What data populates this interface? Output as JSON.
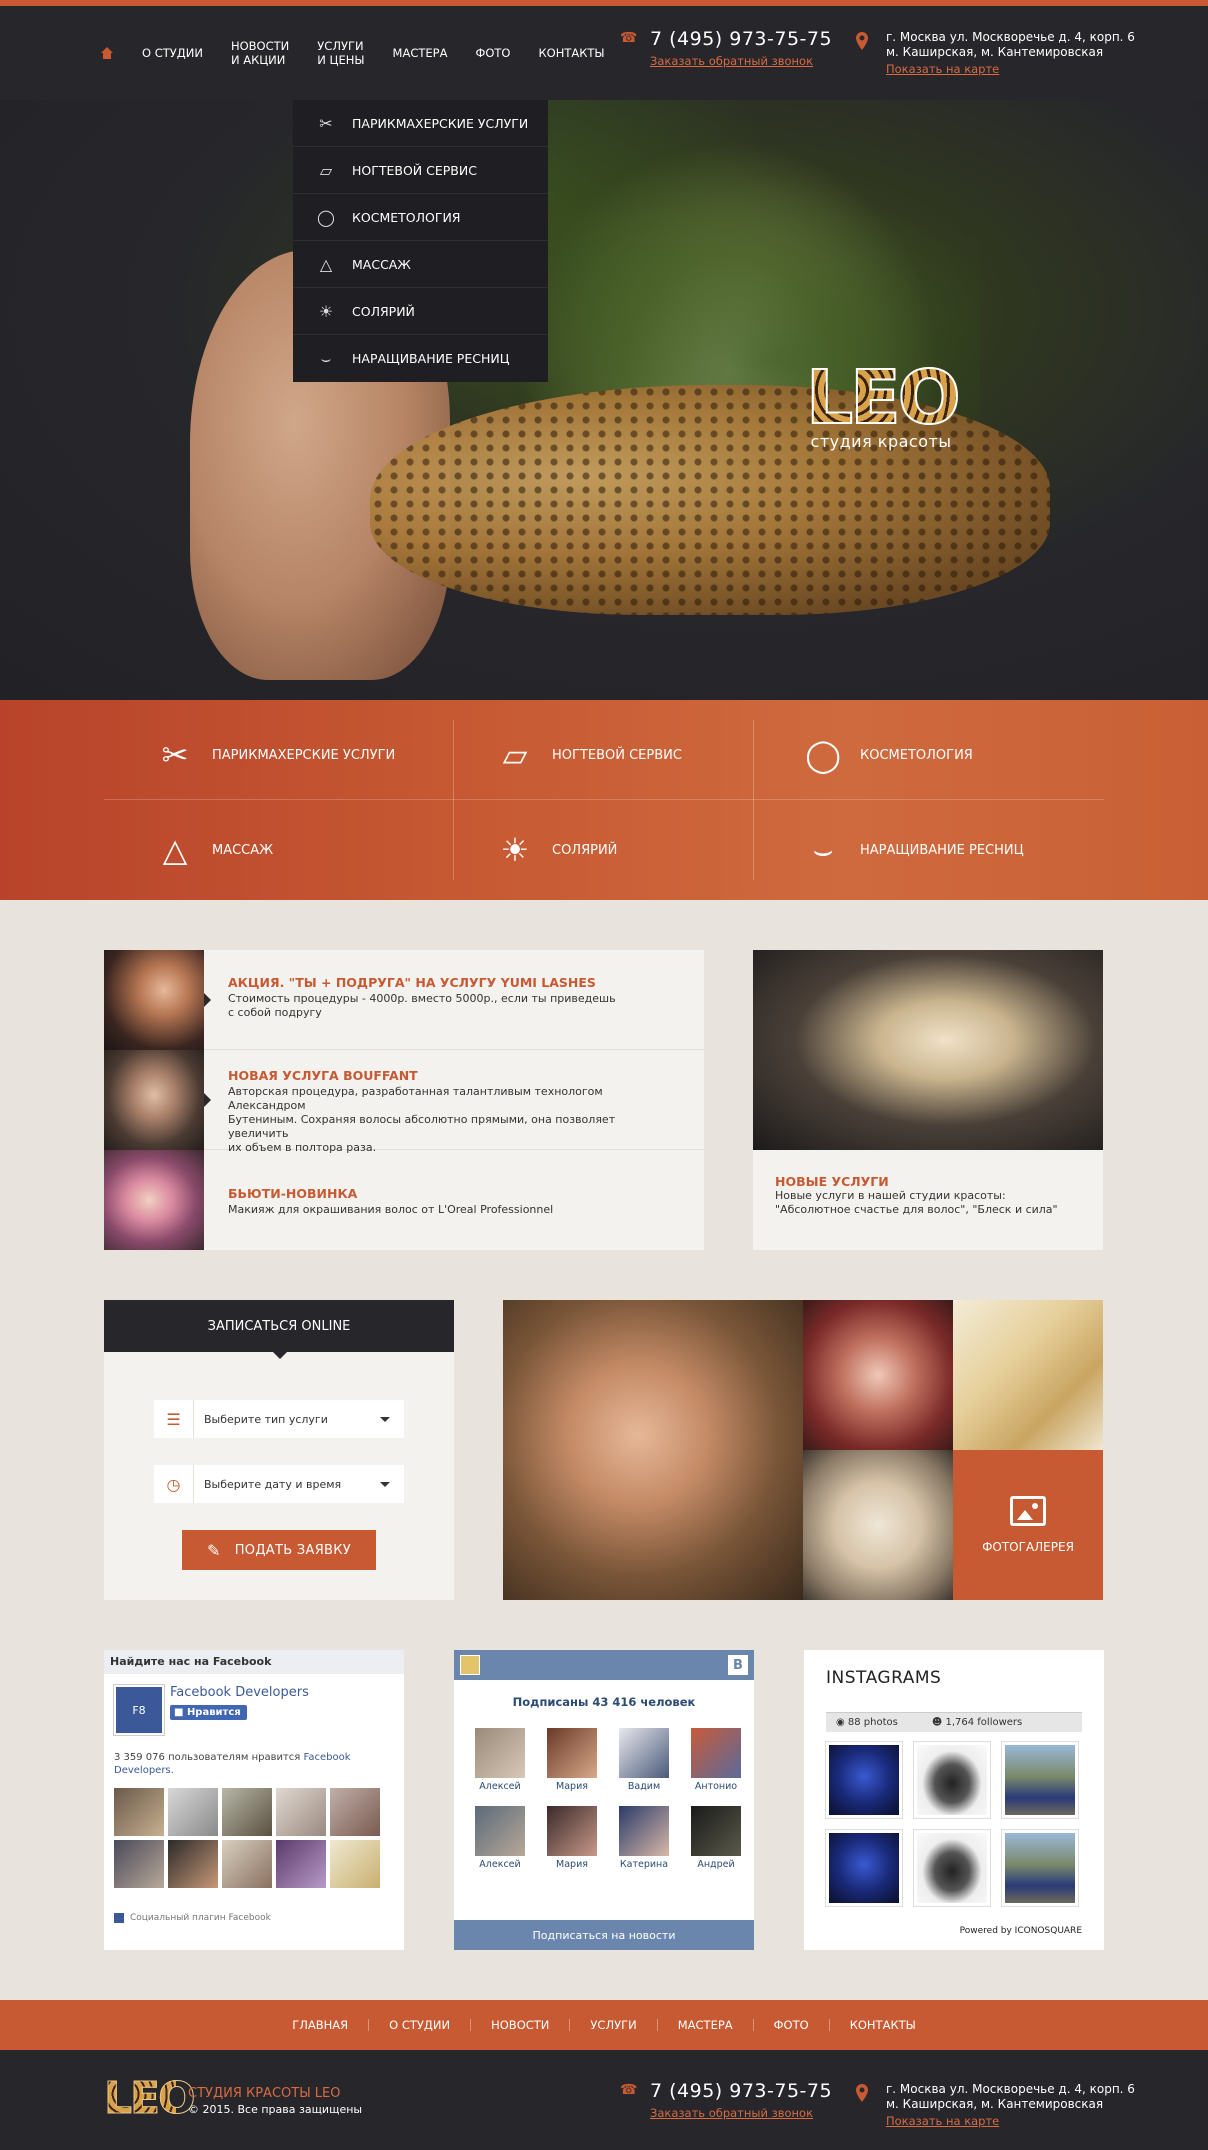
{
  "header": {
    "nav": [
      "О СТУДИИ",
      "НОВОСТИ\nИ АКЦИИ",
      "УСЛУГИ\nИ ЦЕНЫ",
      "МАСТЕРА",
      "ФОТО",
      "КОНТАКТЫ"
    ],
    "phone": "7 (495) 973-75-75",
    "callback": "Заказать обратный звонок",
    "address_line1": "г. Москва ул. Москворечье д. 4, корп. 6",
    "address_line2": "м. Каширская, м. Кантемировская",
    "map_link": "Показать на карте"
  },
  "hero": {
    "logo": "LEO",
    "logo_sub": "студия красоты"
  },
  "dropdown": [
    {
      "label": "ПАРИКМАХЕРСКИЕ УСЛУГИ",
      "icon": "scissors-icon"
    },
    {
      "label": "НОГТЕВОЙ СЕРВИС",
      "icon": "nail-polish-icon"
    },
    {
      "label": "КОСМЕТОЛОГИЯ",
      "icon": "compact-icon"
    },
    {
      "label": "МАССАЖ",
      "icon": "massage-icon"
    },
    {
      "label": "СОЛЯРИЙ",
      "icon": "sun-icon"
    },
    {
      "label": "НАРАЩИВАНИЕ РЕСНИЦ",
      "icon": "eyelash-icon"
    }
  ],
  "services": [
    {
      "label": "ПАРИКМАХЕРСКИЕ УСЛУГИ",
      "icon": "scissors-icon"
    },
    {
      "label": "НОГТЕВОЙ СЕРВИС",
      "icon": "nail-polish-icon"
    },
    {
      "label": "КОСМЕТОЛОГИЯ",
      "icon": "compact-icon"
    },
    {
      "label": "МАССАЖ",
      "icon": "massage-icon"
    },
    {
      "label": "СОЛЯРИЙ",
      "icon": "sun-icon"
    },
    {
      "label": "НАРАЩИВАНИЕ РЕСНИЦ",
      "icon": "eyelash-icon"
    }
  ],
  "news": [
    {
      "title": "АКЦИЯ. \"ТЫ + ПОДРУГА\" НА УСЛУГУ YUMI LASHES",
      "desc": "Стоимость процедуры - 4000р. вместо 5000р., если ты приведешь\nс собой подругу"
    },
    {
      "title": "НОВАЯ УСЛУГА BOUFFANT",
      "desc": "Авторская процедура, разработанная талантливым технологом Александром\nБутениным. Сохраняя волосы абсолютно прямыми, она позволяет увеличить\nих объем в полтора раза."
    },
    {
      "title": "БЬЮТИ-НОВИНКА",
      "desc": "Макияж для окрашивания волос от L'Oreal Professionnel"
    }
  ],
  "feature": {
    "title": "НОВЫЕ УСЛУГИ",
    "desc": "Новые услуги в нашей студии красоты:\n\"Абсолютное счастье для волос\", \"Блеск и сила\""
  },
  "booking": {
    "title": "ЗАПИСАТЬСЯ ONLINE",
    "service_select": "Выберите тип услуги",
    "date_select": "Выберите дату и время",
    "submit": "ПОДАТЬ ЗАЯВКУ"
  },
  "gallery": {
    "label": "ФОТОГАЛЕРЕЯ"
  },
  "facebook": {
    "header": "Найдите нас на Facebook",
    "page_name": "Facebook Developers",
    "page_badge": "F8",
    "like": "Нравится",
    "count_text": "3 359 076 пользователям нравится",
    "count_link": "Facebook Developers.",
    "footer": "Социальный плагин Facebook"
  },
  "vk": {
    "logo": "В",
    "subscribers": "Подписаны 43 416 человек",
    "people": [
      "Алексей",
      "Мария",
      "Вадим",
      "Антонио",
      "Алексей",
      "Мария",
      "Катерина",
      "Андрей"
    ],
    "button": "Подписаться на новости"
  },
  "instagram": {
    "title": "INSTAGRAMS",
    "photos": "88 photos",
    "followers": "1,764 followers",
    "powered": "Powered by ICONOSQUARE"
  },
  "footer": {
    "nav": [
      "ГЛАВНАЯ",
      "О СТУДИИ",
      "НОВОСТИ",
      "УСЛУГИ",
      "МАСТЕРА",
      "ФОТО",
      "КОНТАКТЫ"
    ],
    "logo": "LEO",
    "studio": "СТУДИЯ КРАСОТЫ LEO",
    "copyright": "© 2015. Все права защищены",
    "phone": "7 (495) 973-75-75",
    "callback": "Заказать обратный звонок",
    "address_line1": "г. Москва ул. Москворечье д. 4, корп. 6",
    "address_line2": "м. Каширская, м. Кантемировская",
    "map_link": "Показать на карте"
  },
  "colors": {
    "accent": "#c85a33",
    "dark": "#26262b",
    "light": "#f4f2ee",
    "page": "#e8e4dd"
  }
}
